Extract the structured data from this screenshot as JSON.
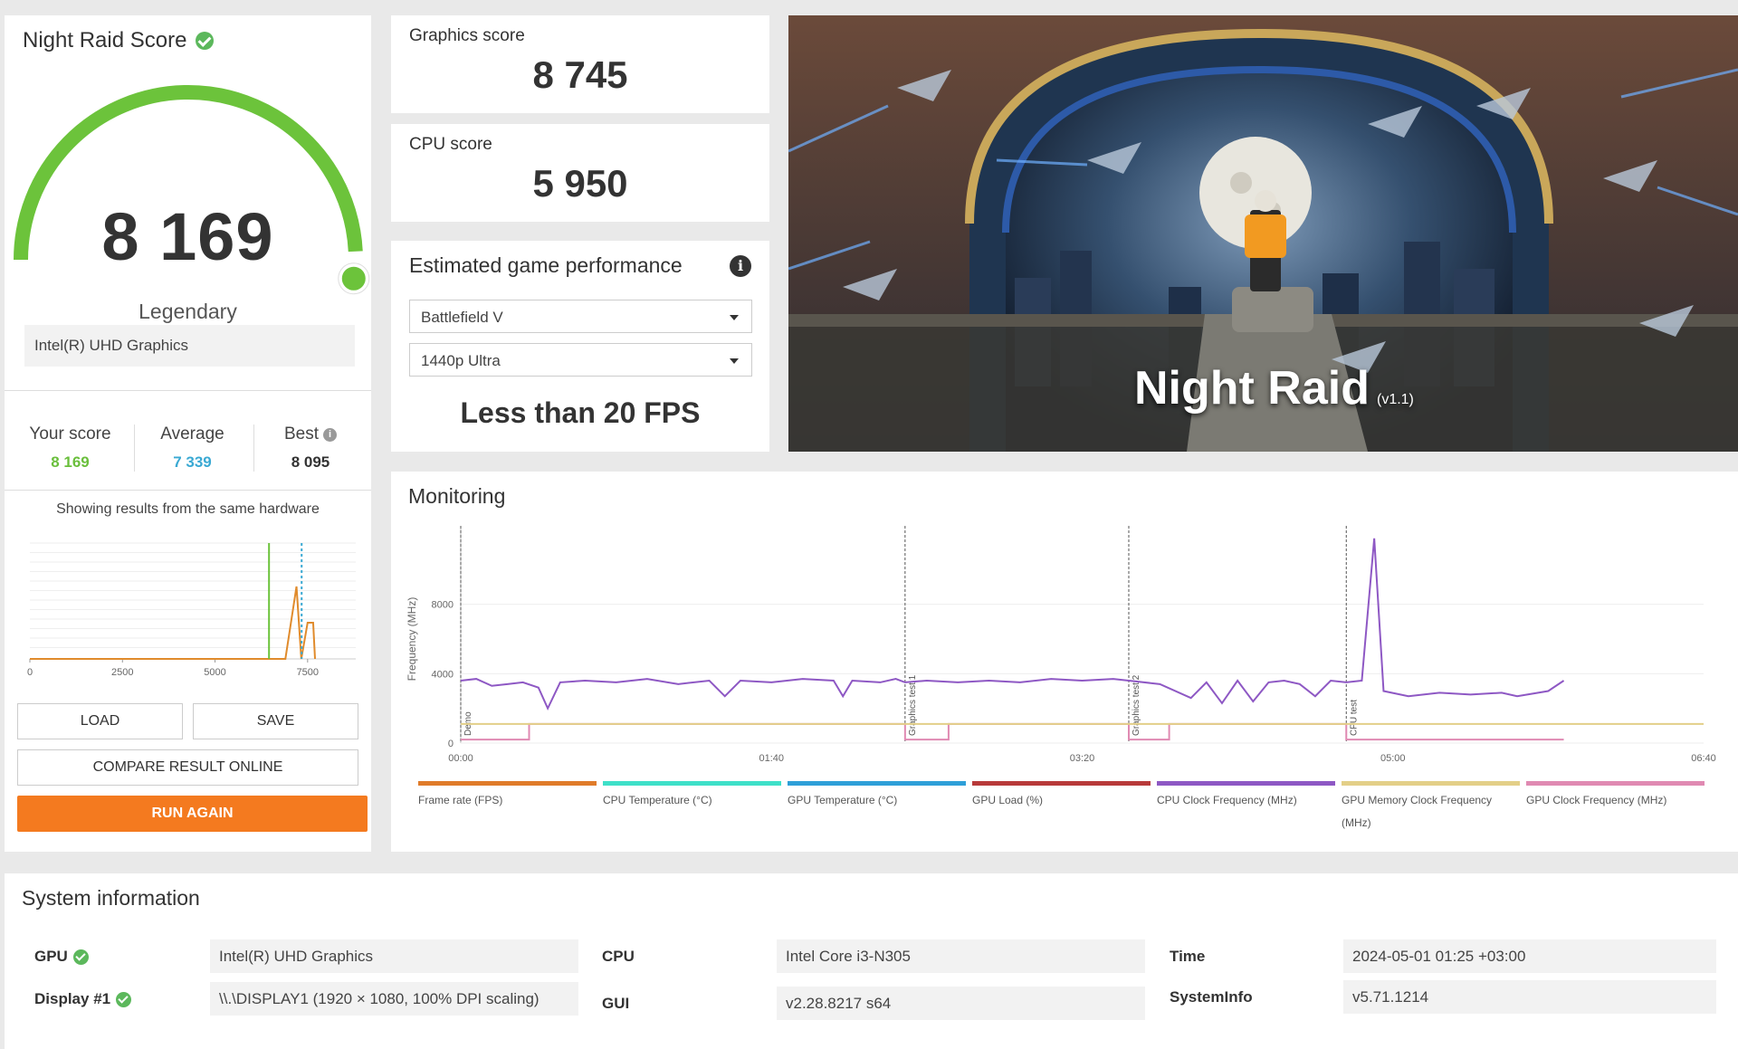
{
  "score_panel": {
    "title": "Night Raid Score",
    "score": "8 169",
    "gauge_fraction": 0.95,
    "rank": "Legendary",
    "hardware": "Intel(R) UHD Graphics",
    "stats": [
      {
        "label": "Your score",
        "value": "8 169",
        "color": "#6abf3c"
      },
      {
        "label": "Average",
        "value": "7 339",
        "color": "#3aa9d3"
      },
      {
        "label": "Best",
        "value": "8 095",
        "color": "#333333"
      }
    ],
    "same_hw_text": "Showing results from the same hardware",
    "dist_ticks": [
      "0",
      "2500",
      "5000",
      "7500"
    ],
    "buttons": {
      "load": "LOAD",
      "save": "SAVE",
      "compare": "COMPARE RESULT ONLINE",
      "run": "RUN AGAIN"
    }
  },
  "graphics_score": {
    "label": "Graphics score",
    "value": "8 745"
  },
  "cpu_score": {
    "label": "CPU score",
    "value": "5 950"
  },
  "estimated": {
    "title": "Estimated game performance",
    "game": "Battlefield V",
    "preset": "1440p Ultra",
    "result": "Less than 20 FPS"
  },
  "hero": {
    "title": "Night Raid",
    "version": "(v1.1)"
  },
  "monitoring": {
    "title": "Monitoring",
    "y_axis_label": "Frequency (MHz)",
    "y_ticks": [
      "0",
      "4000",
      "8000"
    ],
    "x_ticks": [
      "00:00",
      "01:40",
      "03:20",
      "05:00",
      "06:40"
    ],
    "phase_labels": [
      "Demo",
      "Graphics test 1",
      "Graphics test 2",
      "CPU test"
    ],
    "legend": [
      {
        "label": "Frame rate (FPS)",
        "color": "#e07b2a"
      },
      {
        "label": "CPU Temperature (°C)",
        "color": "#3ee0c8"
      },
      {
        "label": "GPU Temperature (°C)",
        "color": "#2e9fd8"
      },
      {
        "label": "GPU Load (%)",
        "color": "#b83a3a"
      },
      {
        "label": "CPU Clock Frequency (MHz)",
        "color": "#8e58c4"
      },
      {
        "label": "GPU Memory Clock Frequency",
        "label2": "(MHz)",
        "color": "#e3cf88"
      },
      {
        "label": "GPU Clock Frequency (MHz)",
        "color": "#e08ab2"
      }
    ]
  },
  "chart_data": {
    "type": "line",
    "title": "Monitoring",
    "ylabel": "Frequency (MHz)",
    "xlabel": "",
    "ylim": [
      0,
      12000
    ],
    "xlim_seconds": [
      0,
      400
    ],
    "x_ticks": [
      "00:00",
      "01:40",
      "03:20",
      "05:00",
      "06:40"
    ],
    "phase_markers": [
      {
        "t": 0,
        "label": "Demo"
      },
      {
        "t": 143,
        "label": "Graphics test 1"
      },
      {
        "t": 215,
        "label": "Graphics test 2"
      },
      {
        "t": 285,
        "label": "CPU test"
      }
    ],
    "series": [
      {
        "name": "CPU Clock Frequency (MHz)",
        "points": [
          [
            0,
            3600
          ],
          [
            5,
            3700
          ],
          [
            10,
            3300
          ],
          [
            15,
            3400
          ],
          [
            20,
            3500
          ],
          [
            25,
            3200
          ],
          [
            28,
            2000
          ],
          [
            32,
            3500
          ],
          [
            40,
            3600
          ],
          [
            50,
            3500
          ],
          [
            60,
            3700
          ],
          [
            70,
            3400
          ],
          [
            80,
            3600
          ],
          [
            85,
            2700
          ],
          [
            90,
            3600
          ],
          [
            100,
            3500
          ],
          [
            110,
            3700
          ],
          [
            120,
            3600
          ],
          [
            123,
            2700
          ],
          [
            126,
            3600
          ],
          [
            135,
            3500
          ],
          [
            140,
            3700
          ],
          [
            143,
            3500
          ],
          [
            150,
            3600
          ],
          [
            160,
            3500
          ],
          [
            170,
            3600
          ],
          [
            180,
            3500
          ],
          [
            190,
            3700
          ],
          [
            200,
            3600
          ],
          [
            210,
            3700
          ],
          [
            215,
            3600
          ],
          [
            225,
            3400
          ],
          [
            235,
            2600
          ],
          [
            240,
            3500
          ],
          [
            245,
            2300
          ],
          [
            250,
            3600
          ],
          [
            255,
            2400
          ],
          [
            260,
            3500
          ],
          [
            265,
            3600
          ],
          [
            270,
            3400
          ],
          [
            275,
            2700
          ],
          [
            280,
            3600
          ],
          [
            285,
            3500
          ],
          [
            290,
            3600
          ],
          [
            294,
            11800
          ],
          [
            297,
            3000
          ],
          [
            305,
            2700
          ],
          [
            315,
            2900
          ],
          [
            325,
            2800
          ],
          [
            335,
            2900
          ],
          [
            340,
            2700
          ],
          [
            350,
            3000
          ],
          [
            355,
            3600
          ]
        ]
      },
      {
        "name": "GPU Memory Clock Frequency (MHz)",
        "points": [
          [
            0,
            1100
          ],
          [
            400,
            1100
          ]
        ]
      },
      {
        "name": "GPU Clock Frequency (MHz)",
        "points": [
          [
            0,
            200
          ],
          [
            22,
            200
          ],
          [
            22,
            1100
          ],
          [
            143,
            1100
          ],
          [
            143,
            200
          ],
          [
            157,
            200
          ],
          [
            157,
            1100
          ],
          [
            215,
            1100
          ],
          [
            215,
            200
          ],
          [
            228,
            200
          ],
          [
            228,
            1100
          ],
          [
            285,
            1100
          ],
          [
            285,
            200
          ],
          [
            355,
            200
          ]
        ]
      }
    ]
  },
  "sysinfo": {
    "title": "System information",
    "gpu_label": "GPU",
    "gpu_value": "Intel(R) UHD Graphics",
    "display_label": "Display #1",
    "display_value": "\\\\.\\DISPLAY1 (1920 × 1080, 100% DPI scaling)",
    "cpu_label": "CPU",
    "cpu_value": "Intel Core i3-N305",
    "gui_label": "GUI",
    "gui_value": "v2.28.8217 s64",
    "time_label": "Time",
    "time_value": "2024-05-01 01:25 +03:00",
    "sysinfo_label": "SystemInfo",
    "sysinfo_value": "v5.71.1214"
  }
}
